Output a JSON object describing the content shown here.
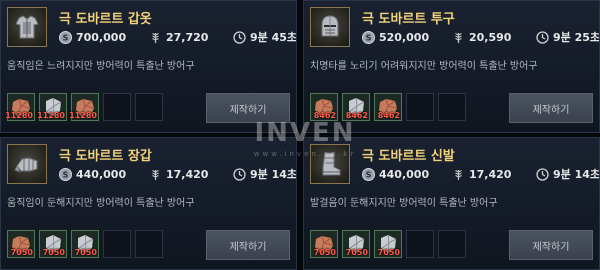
{
  "recipes": [
    {
      "name": "극 도바르트 갑옷",
      "icon": "chest-armor-icon",
      "silver": "700,000",
      "energy": "27,720",
      "time": "9분 45초",
      "description": "움직임은 느려지지만 방어력이 특출난 방어구",
      "materials": [
        {
          "kind": "copper-ore",
          "count": "11280"
        },
        {
          "kind": "silver-ore",
          "count": "11280"
        },
        {
          "kind": "copper-ore",
          "count": "11280"
        },
        {
          "kind": "empty",
          "count": ""
        },
        {
          "kind": "empty",
          "count": ""
        }
      ],
      "button": "제작하기"
    },
    {
      "name": "극 도바르트 투구",
      "icon": "helmet-icon",
      "silver": "520,000",
      "energy": "20,590",
      "time": "9분 25초",
      "description": "치명타를 노리기 어려워지지만 방어력이 특출난 방어구",
      "materials": [
        {
          "kind": "copper-ore",
          "count": "8462"
        },
        {
          "kind": "silver-ore",
          "count": "8462"
        },
        {
          "kind": "copper-ore",
          "count": "8462"
        },
        {
          "kind": "empty",
          "count": ""
        },
        {
          "kind": "empty",
          "count": ""
        }
      ],
      "button": "제작하기"
    },
    {
      "name": "극 도바르트 장갑",
      "icon": "gauntlet-icon",
      "silver": "440,000",
      "energy": "17,420",
      "time": "9분 14초",
      "description": "움직임이 둔해지지만 방어력이 특출난 방어구",
      "materials": [
        {
          "kind": "copper-ore",
          "count": "7050"
        },
        {
          "kind": "silver-ore",
          "count": "7050"
        },
        {
          "kind": "silver-ore",
          "count": "7050"
        },
        {
          "kind": "empty",
          "count": ""
        },
        {
          "kind": "empty",
          "count": ""
        }
      ],
      "button": "제작하기"
    },
    {
      "name": "극 도바르트 신발",
      "icon": "boots-icon",
      "silver": "440,000",
      "energy": "17,420",
      "time": "9분 14초",
      "description": "발걸음이 둔해지지만 방어력이 특출난 방어구",
      "materials": [
        {
          "kind": "copper-ore",
          "count": "7050"
        },
        {
          "kind": "silver-ore",
          "count": "7050"
        },
        {
          "kind": "silver-ore",
          "count": "7050"
        },
        {
          "kind": "empty",
          "count": ""
        },
        {
          "kind": "empty",
          "count": ""
        }
      ],
      "button": "제작하기"
    }
  ],
  "watermark": {
    "logo": "INVEN",
    "site": "www.inven.co.kr"
  },
  "colors": {
    "title": "#f2d27a",
    "material_count": "#ff5a4a"
  }
}
